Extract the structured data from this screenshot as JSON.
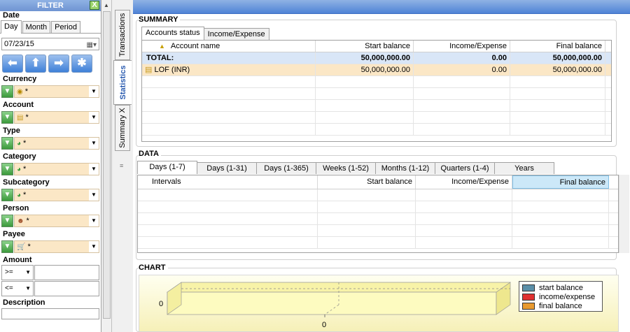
{
  "filter": {
    "title": "FILTER",
    "close_label": "X",
    "date": {
      "label": "Date",
      "tabs": [
        "Day",
        "Month",
        "Period"
      ],
      "active_tab": "Day",
      "value": "07/23/15"
    },
    "currency": {
      "label": "Currency",
      "value": "*",
      "icon": "coins-icon"
    },
    "account": {
      "label": "Account",
      "value": "*",
      "icon": "account-icon"
    },
    "type": {
      "label": "Type",
      "value": "*",
      "icon": "pie-icon"
    },
    "category": {
      "label": "Category",
      "value": "*",
      "icon": "pie-icon"
    },
    "subcategory": {
      "label": "Subcategory",
      "value": "*",
      "icon": "pie-icon"
    },
    "person": {
      "label": "Person",
      "value": "*",
      "icon": "person-icon"
    },
    "payee": {
      "label": "Payee",
      "value": "*",
      "icon": "cart-icon"
    },
    "amount": {
      "label": "Amount",
      "op1": ">=",
      "op2": "<="
    },
    "description": {
      "label": "Description"
    }
  },
  "vertical_tabs": [
    "Transactions",
    "Statistics",
    "Summary X"
  ],
  "active_vertical_tab": "Statistics",
  "summary": {
    "title": "SUMMARY",
    "tabs": [
      "Accounts status",
      "Income/Expense"
    ],
    "columns": [
      "Account name",
      "Start balance",
      "Income/Expense",
      "Final balance"
    ],
    "rows": [
      {
        "name": "TOTAL:",
        "start": "50,000,000.00",
        "income": "0.00",
        "final": "50,000,000.00"
      },
      {
        "name": "LOF (INR)",
        "start": "50,000,000.00",
        "income": "0.00",
        "final": "50,000,000.00"
      }
    ]
  },
  "data": {
    "title": "DATA",
    "tabs": [
      "Days (1-7)",
      "Days (1-31)",
      "Days (1-365)",
      "Weeks (1-52)",
      "Months (1-12)",
      "Quarters (1-4)",
      "Years"
    ],
    "columns": [
      "Intervals",
      "Start balance",
      "Income/Expense",
      "Final balance"
    ]
  },
  "chart": {
    "title": "CHART",
    "y_tick": "0",
    "x_tick": "0",
    "legend": [
      {
        "label": "start balance",
        "color": "#5b8fa8"
      },
      {
        "label": "income/expense",
        "color": "#e03030"
      },
      {
        "label": "final balance",
        "color": "#e89a30"
      }
    ]
  }
}
